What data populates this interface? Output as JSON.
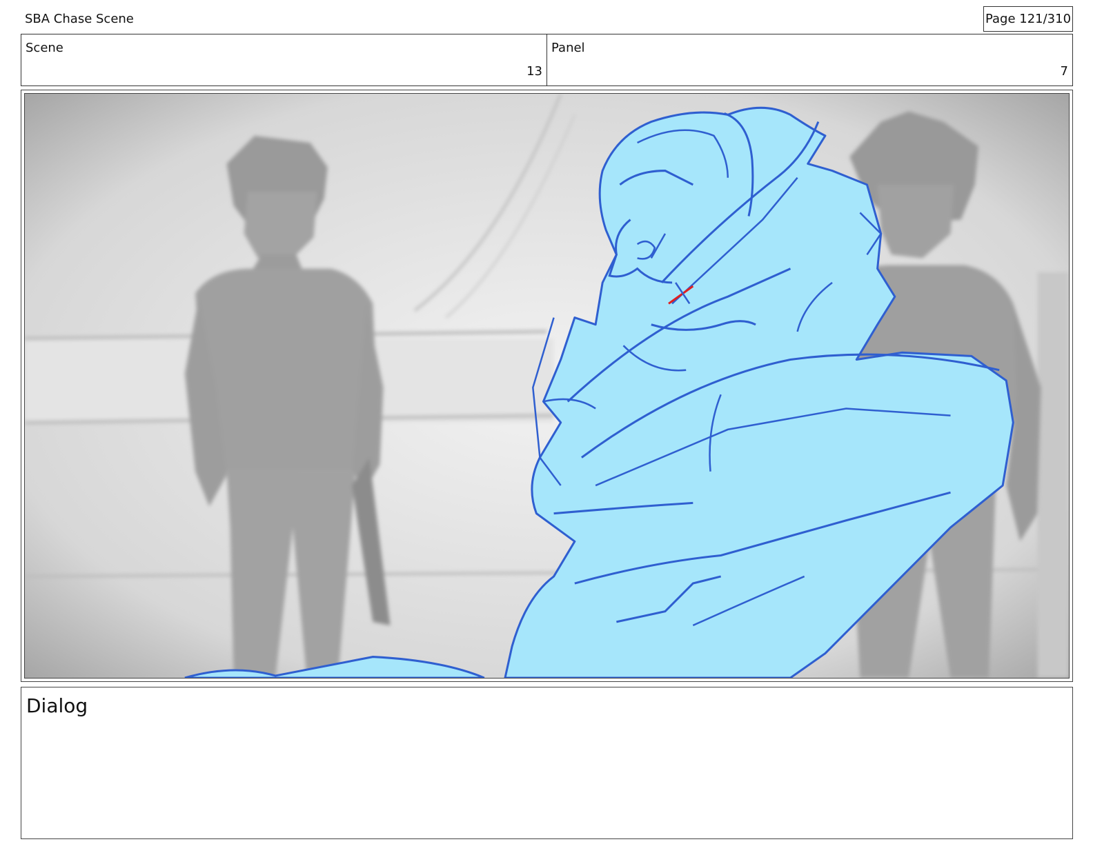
{
  "header": {
    "title": "SBA Chase Scene",
    "page": "Page 121/310"
  },
  "info": {
    "scene_label": "Scene",
    "scene_value": "13",
    "panel_label": "Panel",
    "panel_value": "7"
  },
  "frame": {
    "foreground_color": "#a6e6fb",
    "line_color": "#2f5fd0",
    "accent_color": "#e02020",
    "background_color": "#d8d8d8"
  },
  "dialog": {
    "label": "Dialog"
  }
}
